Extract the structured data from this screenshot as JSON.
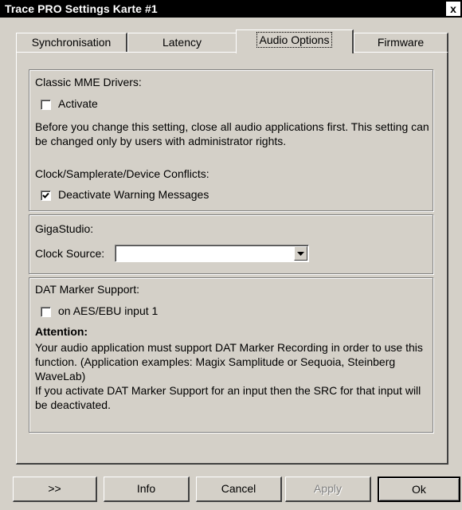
{
  "window": {
    "title": "Trace PRO Settings Karte #1",
    "close_label": "x"
  },
  "tabs": [
    {
      "label": "Synchronisation",
      "active": false
    },
    {
      "label": "Latency",
      "active": false
    },
    {
      "label": "Audio Options",
      "active": true
    },
    {
      "label": "Firmware",
      "active": false
    }
  ],
  "mme": {
    "heading": "Classic MME Drivers:",
    "activate_label": "Activate",
    "activate_checked": false,
    "note": "Before you change this setting, close all audio applications first. This setting can be changed only by users with administrator rights.",
    "conflicts_heading": "Clock/Samplerate/Device Conflicts:",
    "deactivate_label": "Deactivate Warning Messages",
    "deactivate_checked": true
  },
  "giga": {
    "heading": "GigaStudio:",
    "clock_label": "Clock Source:",
    "clock_value": ""
  },
  "dat": {
    "heading": "DAT Marker Support:",
    "aes_label": "on AES/EBU input 1",
    "aes_checked": false,
    "attention_label": "Attention:",
    "attention_text1": "Your audio application must support DAT Marker Recording in order to use this function. (Application examples: Magix Samplitude or Sequoia, Steinberg WaveLab)",
    "attention_text2": "If you activate DAT Marker Support for an input then the SRC for that input will be deactivated."
  },
  "buttons": {
    "more_label": ">>",
    "info_label": "Info",
    "cancel_label": "Cancel",
    "apply_label": "Apply",
    "ok_label": "Ok"
  }
}
